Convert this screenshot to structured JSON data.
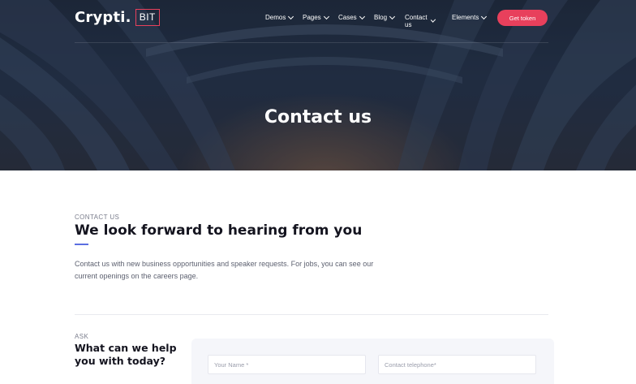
{
  "header": {
    "logo_text": "Crypti.",
    "logo_badge": "BIT",
    "nav": [
      {
        "label": "Demos",
        "icon": "chevron-down-icon"
      },
      {
        "label": "Pages",
        "icon": "chevron-down-icon"
      },
      {
        "label": "Cases",
        "icon": "chevron-down-icon"
      },
      {
        "label": "Blog",
        "icon": "chevron-down-icon"
      },
      {
        "label": "Contact us",
        "icon": "chevron-down-icon"
      },
      {
        "label": "Elements",
        "icon": "chevron-down-icon"
      }
    ],
    "cta_label": "Get token"
  },
  "hero": {
    "title": "Contact us"
  },
  "contact": {
    "eyebrow": "CONTACT US",
    "heading": "We look forward to hearing from you",
    "paragraph": "Contact us with new business opportunities and speaker requests. For jobs, you can see our current openings on the careers page."
  },
  "ask": {
    "eyebrow": "ASK",
    "heading_line1": "What can we help",
    "heading_line2": "you with today?"
  },
  "form": {
    "name_placeholder": "Your Name *",
    "phone_placeholder": "Contact telephone*"
  },
  "colors": {
    "accent": "#e8405c",
    "accent_bar": "#5b6ee1",
    "hero_dark": "#1f2a3d"
  }
}
